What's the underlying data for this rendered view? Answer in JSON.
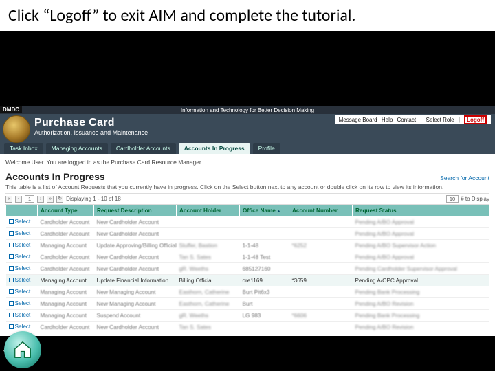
{
  "instruction": "Click “Logoff” to exit AIM and complete the tutorial.",
  "brand": {
    "dmdc": "DMDC",
    "tagline": "Information and Technology for Better Decision Making"
  },
  "header": {
    "title": "Purchase Card",
    "subtitle": "Authorization, Issuance and Maintenance",
    "links": {
      "msg": "Message Board",
      "help": "Help",
      "contact": "Contact",
      "role": "Select Role",
      "logoff": "Logoff",
      "sep": "|"
    }
  },
  "tabs": [
    "Task Inbox",
    "Managing Accounts",
    "Cardholder Accounts",
    "Accounts In Progress",
    "Profile"
  ],
  "active_tab": 3,
  "welcome": "Welcome User. You are logged in as the Purchase Card Resource Manager .",
  "page": {
    "title": "Accounts In Progress",
    "search": "Search for Account",
    "desc": "This table is a list of Account Requests that you currently have in progress. Click on the Select button next to any account or double click on its row to view its information."
  },
  "pager": {
    "page": "1",
    "display": "Displaying 1 - 10 of 18",
    "per_label": "# to Display",
    "per": "10"
  },
  "columns": [
    "",
    "Account Type",
    "Request Description",
    "Account Holder",
    "Office Name",
    "Account Number",
    "Request Status"
  ],
  "sort_col": 4,
  "select_label": "Select",
  "rows": [
    {
      "type": "Cardholder Account",
      "desc": "New Cardholder Account",
      "holder": "",
      "office": "",
      "acct": "",
      "status": "Pending A/BO Approval"
    },
    {
      "type": "Cardholder Account",
      "desc": "New Cardholder Account",
      "holder": "",
      "office": "",
      "acct": "",
      "status": "Pending A/BO Approval"
    },
    {
      "type": "Managing Account",
      "desc": "Update Approving/Billing Official",
      "holder": "Stuffer, Bastion",
      "office": "1-1-48",
      "acct": "*6252",
      "status": "Pending A/BO Supervisor Action"
    },
    {
      "type": "Cardholder Account",
      "desc": "New Cardholder Account",
      "holder": "Tan S. Sates",
      "office": "1-1-48 Test",
      "acct": "",
      "status": "Pending A/BO Approval"
    },
    {
      "type": "Cardholder Account",
      "desc": "New Cardholder Account",
      "holder": "gR. Weeths",
      "office": "685127160",
      "acct": "",
      "status": "Pending Cardholder Supervisor Approval"
    },
    {
      "type": "Managing Account",
      "desc": "Update Financial Information",
      "holder": "Billing Official",
      "office": "ore1169",
      "acct": "*3659",
      "status": "Pending A/OPC Approval",
      "selected": true
    },
    {
      "type": "Managing Account",
      "desc": "New Managing Account",
      "holder": "Easthorn, Catherine",
      "office": "Burt Pit6x3",
      "acct": "",
      "status": "Pending Bank Processing"
    },
    {
      "type": "Managing Account",
      "desc": "New Managing Account",
      "holder": "Easthorn, Catherine",
      "office": "Burt",
      "acct": "",
      "status": "Pending A/BO Revision"
    },
    {
      "type": "Managing Account",
      "desc": "Suspend Account",
      "holder": "gR. Weeths",
      "office": "LG 983",
      "acct": "*6606",
      "status": "Pending Bank Processing"
    },
    {
      "type": "Cardholder Account",
      "desc": "New Cardholder Account",
      "holder": "Tan S. Sates",
      "office": "",
      "acct": "",
      "status": "Pending A/BO Revision"
    }
  ]
}
